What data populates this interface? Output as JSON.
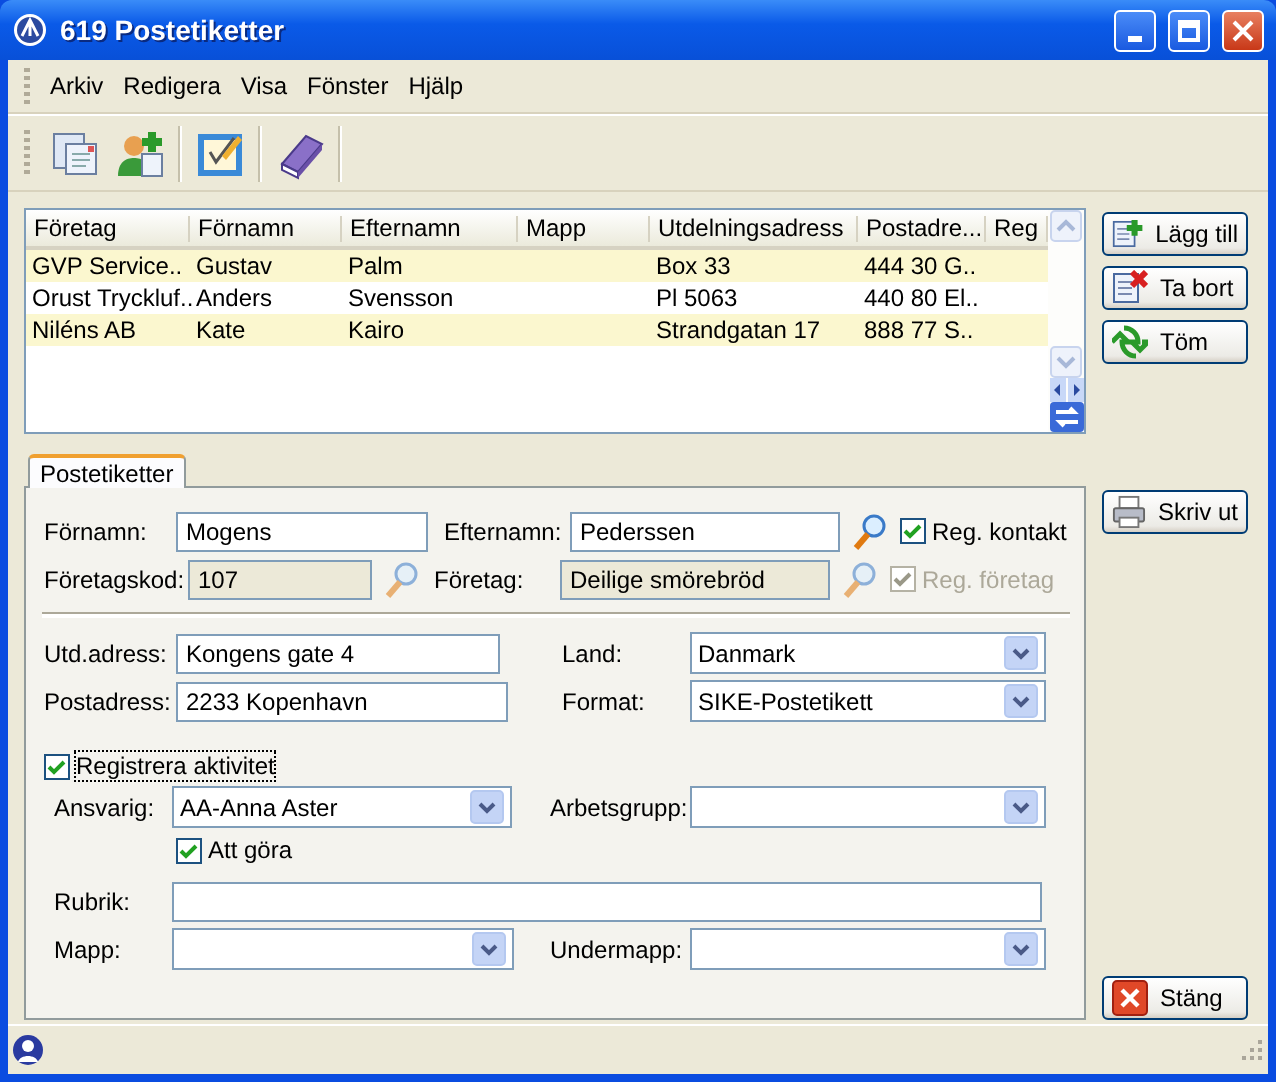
{
  "window": {
    "title": "619 Postetiketter"
  },
  "menu": [
    "Arkiv",
    "Redigera",
    "Visa",
    "Fönster",
    "Hjälp"
  ],
  "list": {
    "columns": [
      "Företag",
      "Förnamn",
      "Efternamn",
      "Mapp",
      "Utdelningsadress",
      "Postadre...",
      "Reg"
    ],
    "rows": [
      [
        "GVP Service..",
        "Gustav",
        "Palm",
        "",
        "Box 33",
        "444 30 G..",
        ""
      ],
      [
        "Orust Tryckluf..",
        "Anders",
        "Svensson",
        "",
        "Pl 5063",
        "440 80 El..",
        ""
      ],
      [
        "Niléns AB",
        "Kate",
        "Kairo",
        "",
        "Strandgatan 17",
        "888 77 S..",
        ""
      ]
    ]
  },
  "side_buttons": [
    {
      "label": "Lägg till",
      "kind": "add"
    },
    {
      "label": "Ta bort",
      "kind": "remove"
    },
    {
      "label": "Töm",
      "kind": "clear"
    }
  ],
  "print_button": {
    "label": "Skriv ut"
  },
  "close_button": {
    "label": "Stäng"
  },
  "tabs": [
    {
      "label": "Postetiketter",
      "selected": true
    }
  ],
  "form": {
    "fornamn": {
      "label": "Förnamn:",
      "value": "Mogens",
      "disabled": false
    },
    "efternamn": {
      "label": "Efternamn:",
      "value": "Pederssen",
      "disabled": false
    },
    "reg_kontakt": {
      "label": "Reg. kontakt",
      "checked": true,
      "disabled": false
    },
    "foretagskod": {
      "label": "Företagskod:",
      "value": "107",
      "disabled": true
    },
    "foretag": {
      "label": "Företag:",
      "value": "Deilige smörebröd",
      "disabled": true
    },
    "reg_foretag": {
      "label": "Reg. företag",
      "checked": true,
      "disabled": true
    },
    "utd_adress": {
      "label": "Utd.adress:",
      "value": "Kongens gate 4",
      "disabled": false
    },
    "postadress": {
      "label": "Postadress:",
      "value": "2233 Kopenhavn",
      "disabled": false
    },
    "land": {
      "label": "Land:",
      "value": "Danmark"
    },
    "format": {
      "label": "Format:",
      "value": "SIKE-Postetikett"
    },
    "registrera_aktivitet": {
      "label": "Registrera aktivitet",
      "checked": true,
      "disabled": false
    },
    "ansvarig": {
      "label": "Ansvarig:",
      "value": "AA-Anna Aster"
    },
    "arbetsgrupp": {
      "label": "Arbetsgrupp:"
    },
    "att_gora": {
      "label": "Att göra",
      "checked": true,
      "disabled": false
    },
    "rubrik": {
      "label": "Rubrik:",
      "disabled": false
    },
    "mapp": {
      "label": "Mapp:"
    },
    "undermapp": {
      "label": "Undermapp:"
    }
  }
}
